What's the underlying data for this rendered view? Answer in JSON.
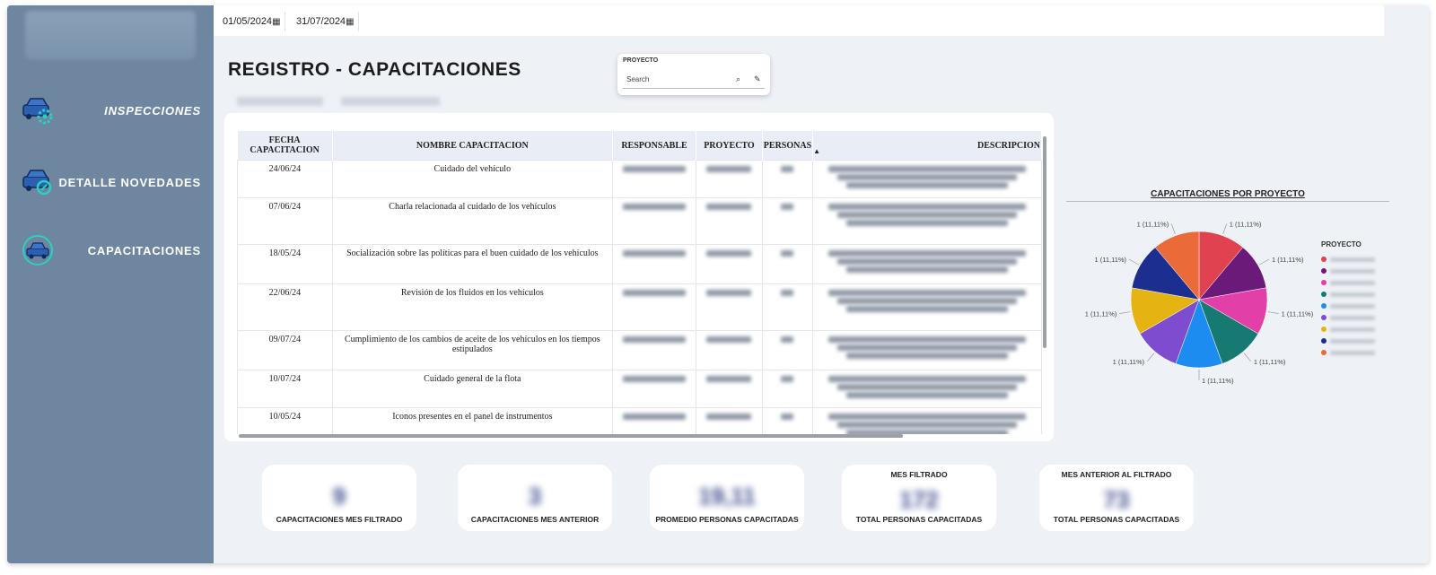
{
  "dates": {
    "start": "01/05/2024",
    "end": "31/07/2024"
  },
  "sidebar": {
    "items": [
      {
        "label": "INSPECCIONES",
        "icon": "car-gear-icon"
      },
      {
        "label": "DETALLE NOVEDADES",
        "icon": "car-search-icon"
      },
      {
        "label": "CAPACITACIONES",
        "icon": "car-wheel-icon"
      }
    ]
  },
  "page_title": "REGISTRO - CAPACITACIONES",
  "filter": {
    "label": "PROYECTO",
    "placeholder": "Search"
  },
  "table": {
    "columns": [
      "FECHA CAPACITACION",
      "NOMBRE CAPACITACION",
      "RESPONSABLE",
      "PROYECTO",
      "PERSONAS",
      "DESCRIPCION"
    ],
    "rows": [
      {
        "fecha": "24/06/24",
        "nombre": "Cuidado del vehículo"
      },
      {
        "fecha": "07/06/24",
        "nombre": "Charla relacionada al cuidado de los vehículos"
      },
      {
        "fecha": "18/05/24",
        "nombre": "Socialización sobre las políticas para el buen cuidado de los vehículos"
      },
      {
        "fecha": "22/06/24",
        "nombre": "Revisión de los fluidos en los vehículos"
      },
      {
        "fecha": "09/07/24",
        "nombre": "Cumplimiento de los cambios de aceite de los vehículos en los tiempos estipulados"
      },
      {
        "fecha": "10/07/24",
        "nombre": "Cuidado general de la flota"
      },
      {
        "fecha": "10/05/24",
        "nombre": "Iconos presentes en el panel de instrumentos"
      }
    ]
  },
  "chart_data": {
    "type": "pie",
    "title": "CAPACITACIONES POR PROYECTO",
    "legend_title": "PROYECTO",
    "values": [
      1,
      1,
      1,
      1,
      1,
      1,
      1,
      1,
      1
    ],
    "labels": [
      "1 (11,11%)",
      "1 (11,11%)",
      "1 (11,11%)",
      "1 (11,11%)",
      "1 (11,11%)",
      "1 (11,11%)",
      "1 (11,11%)",
      "1 (11,11%)",
      "1 (11,11%)"
    ],
    "colors": [
      "#e0424f",
      "#6b1a7a",
      "#e23fa8",
      "#177a72",
      "#1c8cf0",
      "#7d4ccf",
      "#e6b412",
      "#1c2e8f",
      "#ea6a3a"
    ]
  },
  "kpis": [
    {
      "label": "CAPACITACIONES MES FILTRADO",
      "value": "9",
      "top": ""
    },
    {
      "label": "CAPACITACIONES MES ANTERIOR",
      "value": "3",
      "top": ""
    },
    {
      "label": "PROMEDIO PERSONAS CAPACITADAS",
      "value": "19,11",
      "top": ""
    },
    {
      "label": "TOTAL PERSONAS CAPACITADAS",
      "value": "172",
      "top": "MES FILTRADO"
    },
    {
      "label": "TOTAL PERSONAS CAPACITADAS",
      "value": "73",
      "top": "MES ANTERIOR AL FILTRADO"
    }
  ]
}
